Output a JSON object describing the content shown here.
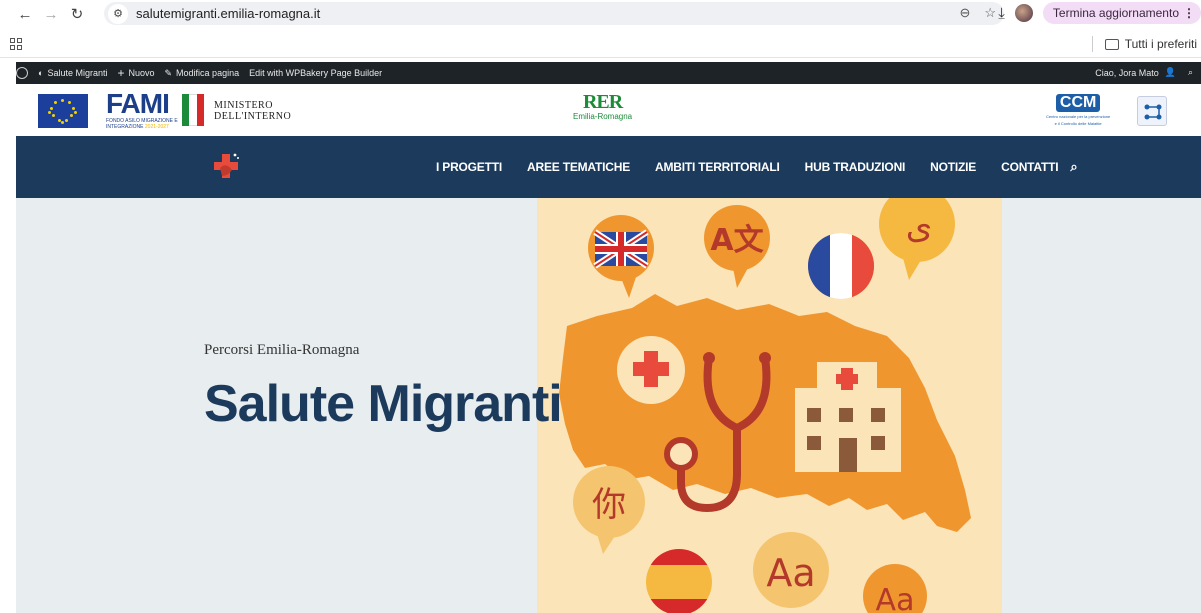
{
  "browser": {
    "url": "salutemigranti.emilia-romagna.it",
    "update_button": "Termina aggiornamento",
    "bookmarks_folder": "Tutti i preferiti"
  },
  "wp_admin_bar": {
    "site": "Salute Migranti",
    "new": "Nuovo",
    "edit_page": "Modifica pagina",
    "edit_builder": "Edit with WPBakery Page Builder",
    "greeting": "Ciao, Jora Mato"
  },
  "logos": {
    "fami": "FAMI",
    "fami_sub_1": "FONDO ASILO MIGRAZIONE E",
    "fami_sub_2": "INTEGRAZIONE",
    "fami_sub_years": "2021-2027",
    "ministero_1": "MINISTERO",
    "ministero_2": "DELL'INTERNO",
    "rer": "RER",
    "rer_region": "Emilia-Romagna",
    "ccm": "CCM",
    "ccm_desc_1": "Centro nazionale per la prevenzione",
    "ccm_desc_2": "e il Controllo delle Malattie"
  },
  "nav": {
    "items": [
      {
        "label": "I PROGETTI"
      },
      {
        "label": "AREE TEMATICHE"
      },
      {
        "label": "AMBITI TERRITORIALI"
      },
      {
        "label": "HUB TRADUZIONI"
      },
      {
        "label": "NOTIZIE"
      },
      {
        "label": "CONTATTI"
      }
    ]
  },
  "hero": {
    "eyebrow": "Percorsi Emilia-Romagna",
    "title": "Salute Migranti",
    "bubbles": {
      "translate": "A文",
      "arabic": "ی",
      "chinese": "你",
      "aa_large": "Aa",
      "aa_small": "Aa"
    }
  },
  "colors": {
    "nav_bg": "#1b3a5c",
    "hero_bg": "#e8edf0",
    "art_bg": "#fbe4b8",
    "orange": "#f0962e",
    "red": "#e84a3b"
  }
}
